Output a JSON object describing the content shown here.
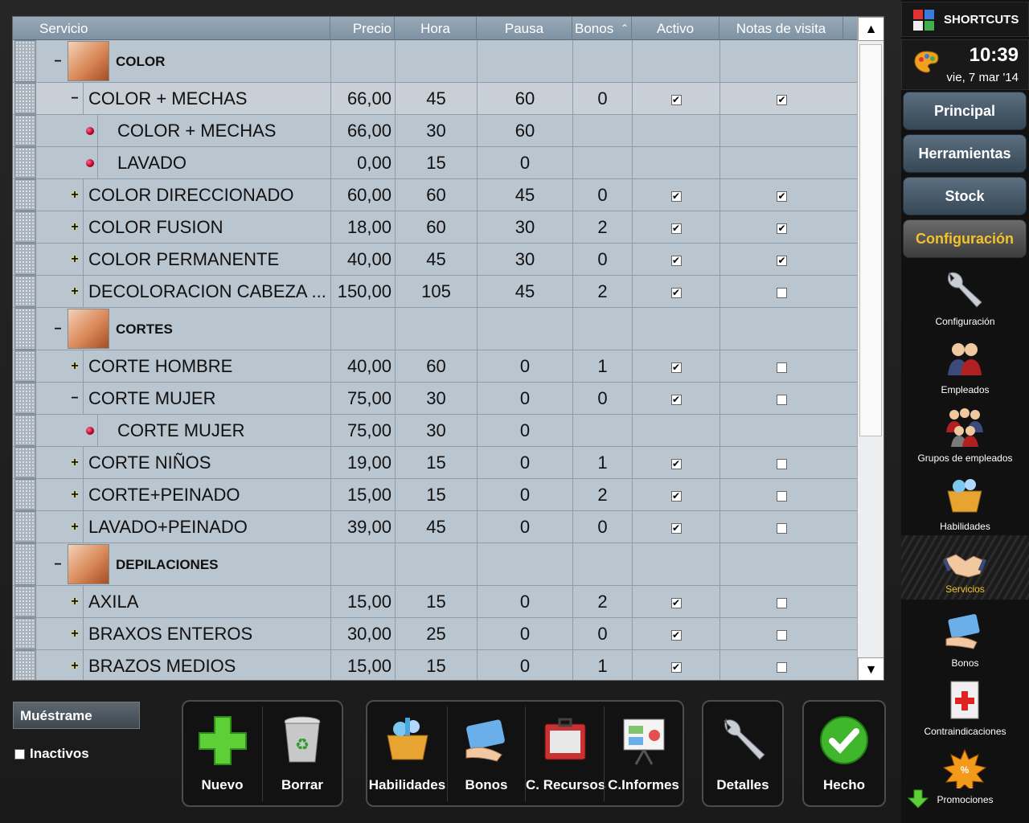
{
  "grid": {
    "columns": {
      "servicio": "Servicio",
      "precio": "Precio",
      "hora": "Hora",
      "pausa": "Pausa",
      "bonos": "Bonos",
      "bonos_sort_icon": "sort-ascending-icon",
      "activo": "Activo",
      "notas": "Notas de visita"
    },
    "rows": [
      {
        "type": "group",
        "name": "COLOR",
        "image": "hair-color-photo"
      },
      {
        "type": "item",
        "expander": "minus",
        "name": "COLOR + MECHAS",
        "precio": "66,00",
        "hora": "45",
        "pausa": "60",
        "bonos": "0",
        "activo": true,
        "notas": true,
        "current": true
      },
      {
        "type": "sub",
        "name": "COLOR + MECHAS",
        "precio": "66,00",
        "hora": "30",
        "pausa": "60"
      },
      {
        "type": "sub",
        "name": "LAVADO",
        "precio": "0,00",
        "hora": "15",
        "pausa": "0"
      },
      {
        "type": "item",
        "expander": "plus",
        "name": "COLOR DIRECCIONADO",
        "precio": "60,00",
        "hora": "60",
        "pausa": "45",
        "bonos": "0",
        "activo": true,
        "notas": true
      },
      {
        "type": "item",
        "expander": "plus",
        "name": "COLOR FUSION",
        "precio": "18,00",
        "hora": "60",
        "pausa": "30",
        "bonos": "2",
        "activo": true,
        "notas": true
      },
      {
        "type": "item",
        "expander": "plus",
        "name": "COLOR PERMANENTE",
        "precio": "40,00",
        "hora": "45",
        "pausa": "30",
        "bonos": "0",
        "activo": true,
        "notas": true
      },
      {
        "type": "item",
        "expander": "plus",
        "name": "DECOLORACION CABEZA ...",
        "precio": "150,00",
        "hora": "105",
        "pausa": "45",
        "bonos": "2",
        "activo": true,
        "notas": false
      },
      {
        "type": "group",
        "name": "CORTES",
        "image": "haircut-photo"
      },
      {
        "type": "item",
        "expander": "plus",
        "name": "CORTE HOMBRE",
        "precio": "40,00",
        "hora": "60",
        "pausa": "0",
        "bonos": "1",
        "activo": true,
        "notas": false
      },
      {
        "type": "item",
        "expander": "minus",
        "name": "CORTE MUJER",
        "precio": "75,00",
        "hora": "30",
        "pausa": "0",
        "bonos": "0",
        "activo": true,
        "notas": false
      },
      {
        "type": "sub",
        "name": "CORTE MUJER",
        "precio": "75,00",
        "hora": "30",
        "pausa": "0"
      },
      {
        "type": "item",
        "expander": "plus",
        "name": "CORTE NIÑOS",
        "precio": "19,00",
        "hora": "15",
        "pausa": "0",
        "bonos": "1",
        "activo": true,
        "notas": false
      },
      {
        "type": "item",
        "expander": "plus",
        "name": "CORTE+PEINADO",
        "precio": "15,00",
        "hora": "15",
        "pausa": "0",
        "bonos": "2",
        "activo": true,
        "notas": false
      },
      {
        "type": "item",
        "expander": "plus",
        "name": "LAVADO+PEINADO",
        "precio": "39,00",
        "hora": "45",
        "pausa": "0",
        "bonos": "0",
        "activo": true,
        "notas": false
      },
      {
        "type": "group",
        "name": "DEPILACIONES",
        "image": "waxing-photo"
      },
      {
        "type": "item",
        "expander": "plus",
        "name": "AXILA",
        "precio": "15,00",
        "hora": "15",
        "pausa": "0",
        "bonos": "2",
        "activo": true,
        "notas": false
      },
      {
        "type": "item",
        "expander": "plus",
        "name": "BRAXOS ENTEROS",
        "precio": "30,00",
        "hora": "25",
        "pausa": "0",
        "bonos": "0",
        "activo": true,
        "notas": false
      },
      {
        "type": "item",
        "expander": "plus",
        "name": "BRAZOS MEDIOS",
        "precio": "15,00",
        "hora": "15",
        "pausa": "0",
        "bonos": "1",
        "activo": true,
        "notas": false
      }
    ]
  },
  "filter": {
    "label": "Muéstrame",
    "inactivos_label": "Inactivos",
    "inactivos_checked": false
  },
  "toolbar": {
    "nuevo": "Nuevo",
    "borrar": "Borrar",
    "habilidades": "Habilidades",
    "bonos": "Bonos",
    "recursos": "C. Recursos",
    "informes": "C.Informes",
    "detalles": "Detalles",
    "hecho": "Hecho"
  },
  "sidebar": {
    "shortcuts": "SHORTCUTS",
    "time": "10:39",
    "date": "vie, 7 mar '14",
    "nav": {
      "principal": "Principal",
      "herramientas": "Herramientas",
      "stock": "Stock",
      "configuracion": "Configuración"
    },
    "items": {
      "configuracion": "Configuración",
      "empleados": "Empleados",
      "grupos": "Grupos de empleados",
      "habilidades": "Habilidades",
      "servicios": "Servicios",
      "bonos": "Bonos",
      "contraindicaciones": "Contraindicaciones",
      "promociones": "Promociones"
    }
  },
  "colors": {
    "accent": "#f4c22a",
    "nav": "#4a5d6d",
    "grid": "#b9c5cf",
    "header": "#8a9cad"
  }
}
